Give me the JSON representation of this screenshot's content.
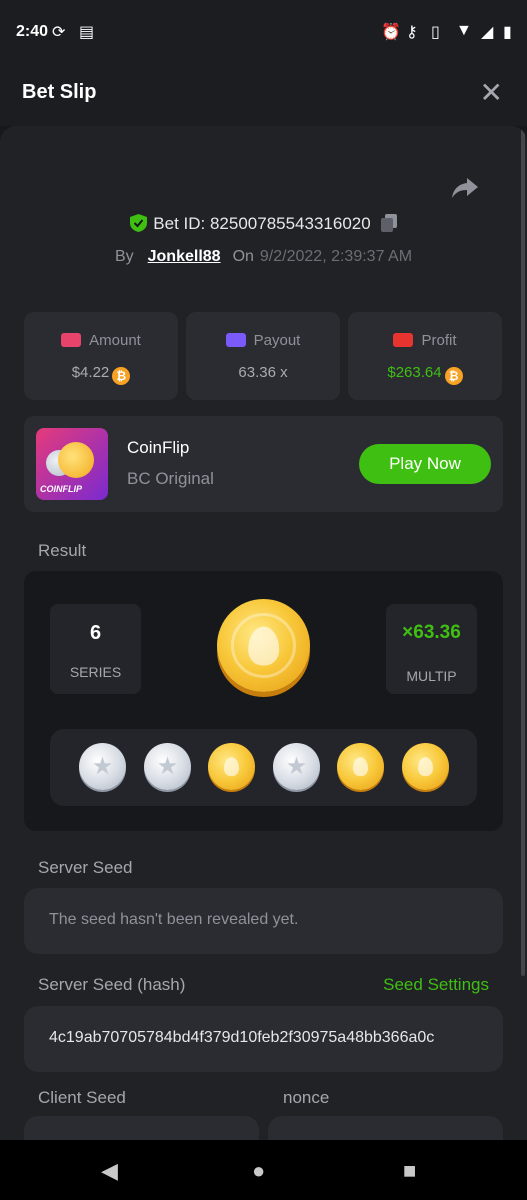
{
  "status": {
    "time": "2:40",
    "icons": [
      "nfc-icon",
      "calendar-icon",
      "alarm-icon",
      "key-icon",
      "vibrate-icon",
      "wifi-icon",
      "signal-icon",
      "battery-icon"
    ]
  },
  "header": {
    "title": "Bet Slip",
    "close_glyph": "✕"
  },
  "bet": {
    "id_label": "Bet ID: 82500785543316020",
    "by_label": "By",
    "user": "Jonkell88",
    "on_label": "On",
    "date": "9/2/2022, 2:39:37 AM"
  },
  "stats": [
    {
      "label": "Amount",
      "value": "$4.22",
      "value_color": "#a9abb2",
      "icon_color": "#e8436a",
      "coin": true
    },
    {
      "label": "Payout",
      "value": "63.36 x",
      "value_color": "#a9abb2",
      "icon_color": "#7a5af8",
      "coin": false
    },
    {
      "label": "Profit",
      "value": "$263.64",
      "value_color": "#3fbf12",
      "icon_color": "#e8342f",
      "coin": true
    }
  ],
  "coin_symbol": "₿",
  "game": {
    "thumb_label": "COINFLIP",
    "name": "CoinFlip",
    "subtitle": "BC Original",
    "play_label": "Play Now"
  },
  "result": {
    "label": "Result",
    "series_value": "6",
    "series_label": "SERIES",
    "multiplier_value": "×63.36",
    "multiplier_label": "MULTIP",
    "coins": [
      "silver",
      "silver",
      "gold",
      "silver",
      "gold",
      "gold"
    ]
  },
  "seeds": {
    "server_seed_label": "Server Seed",
    "server_seed_value": "The seed hasn't been revealed yet.",
    "server_hash_label": "Server Seed (hash)",
    "seed_settings_label": "Seed Settings",
    "server_hash_value": "4c19ab70705784bd4f379d10feb2f30975a48bb366a0c",
    "client_seed_label": "Client Seed",
    "nonce_label": "nonce"
  },
  "colors": {
    "accent": "#3fbf12",
    "background": "#17181b",
    "card": "#2b2c31",
    "gold": "#f8c83a"
  }
}
